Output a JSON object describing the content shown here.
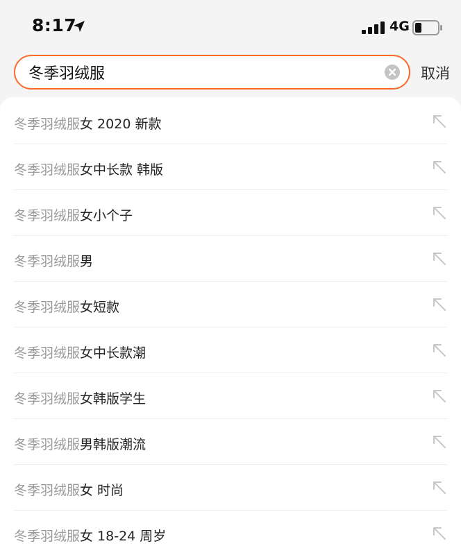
{
  "status_bar": {
    "time": "8:17",
    "network": "4G",
    "location_icon": "location-arrow-icon",
    "signal_icon": "cellular-signal-icon",
    "battery_icon": "battery-icon"
  },
  "search": {
    "value": "冬季羽绒服",
    "accent_color": "#ff6a2b",
    "clear_icon": "clear-icon",
    "cancel_label": "取消"
  },
  "suggestions": {
    "keyword": "冬季羽绒服",
    "fill_icon": "fill-arrow-icon",
    "items": [
      {
        "suffix": "女 2020 新款"
      },
      {
        "suffix": "女中长款 韩版"
      },
      {
        "suffix": "女小个子"
      },
      {
        "suffix": "男"
      },
      {
        "suffix": "女短款"
      },
      {
        "suffix": "女中长款潮"
      },
      {
        "suffix": "女韩版学生"
      },
      {
        "suffix": "男韩版潮流"
      },
      {
        "suffix": "女 时尚"
      },
      {
        "suffix": "女 18-24 周岁"
      }
    ]
  }
}
